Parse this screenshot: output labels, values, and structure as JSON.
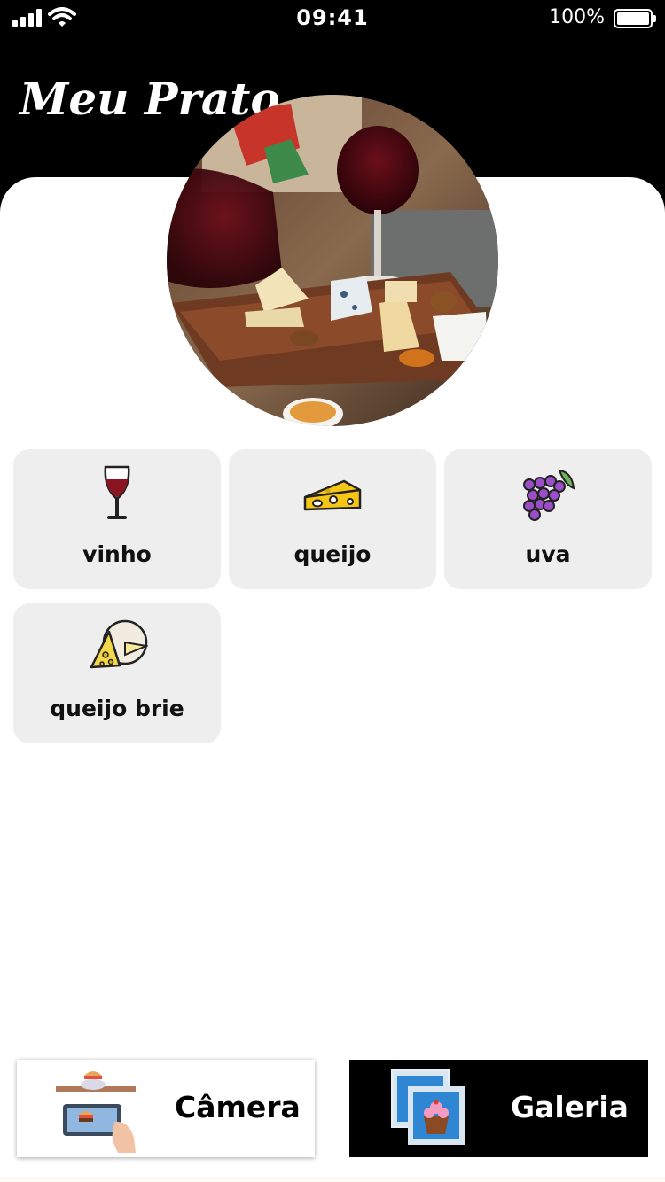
{
  "status_bar": {
    "time": "09:41",
    "battery": "100%"
  },
  "app": {
    "title": "Meu Prato"
  },
  "hero_image": {
    "description_icon": "wine-and-cheese-board-photo"
  },
  "items": [
    {
      "label": "vinho",
      "icon": "wine-glass-icon"
    },
    {
      "label": "queijo",
      "icon": "cheese-icon"
    },
    {
      "label": "uva",
      "icon": "grapes-icon"
    },
    {
      "label": "queijo brie",
      "icon": "brie-cheese-icon"
    }
  ],
  "actions": {
    "camera_label": "Câmera",
    "gallery_label": "Galeria"
  },
  "colors": {
    "header": "#000000",
    "tile": "#eeeeee",
    "gallery_button": "#000000"
  }
}
